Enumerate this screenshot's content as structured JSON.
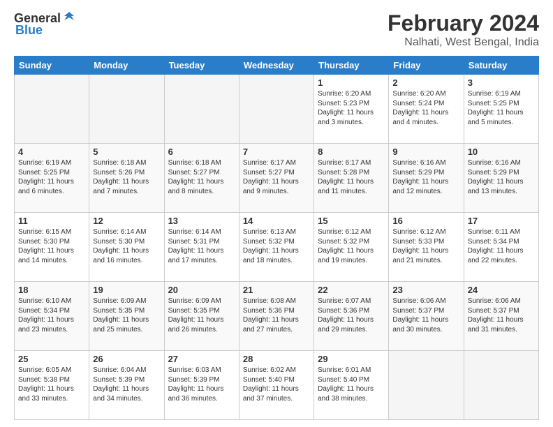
{
  "header": {
    "logo_general": "General",
    "logo_blue": "Blue",
    "title": "February 2024",
    "subtitle": "Nalhati, West Bengal, India"
  },
  "days_of_week": [
    "Sunday",
    "Monday",
    "Tuesday",
    "Wednesday",
    "Thursday",
    "Friday",
    "Saturday"
  ],
  "weeks": [
    [
      {
        "day": "",
        "empty": true
      },
      {
        "day": "",
        "empty": true
      },
      {
        "day": "",
        "empty": true
      },
      {
        "day": "",
        "empty": true
      },
      {
        "day": "1",
        "sunrise": "6:20 AM",
        "sunset": "5:23 PM",
        "daylight": "11 hours and 3 minutes."
      },
      {
        "day": "2",
        "sunrise": "6:20 AM",
        "sunset": "5:24 PM",
        "daylight": "11 hours and 4 minutes."
      },
      {
        "day": "3",
        "sunrise": "6:19 AM",
        "sunset": "5:25 PM",
        "daylight": "11 hours and 5 minutes."
      }
    ],
    [
      {
        "day": "4",
        "sunrise": "6:19 AM",
        "sunset": "5:25 PM",
        "daylight": "11 hours and 6 minutes."
      },
      {
        "day": "5",
        "sunrise": "6:18 AM",
        "sunset": "5:26 PM",
        "daylight": "11 hours and 7 minutes."
      },
      {
        "day": "6",
        "sunrise": "6:18 AM",
        "sunset": "5:27 PM",
        "daylight": "11 hours and 8 minutes."
      },
      {
        "day": "7",
        "sunrise": "6:17 AM",
        "sunset": "5:27 PM",
        "daylight": "11 hours and 9 minutes."
      },
      {
        "day": "8",
        "sunrise": "6:17 AM",
        "sunset": "5:28 PM",
        "daylight": "11 hours and 11 minutes."
      },
      {
        "day": "9",
        "sunrise": "6:16 AM",
        "sunset": "5:29 PM",
        "daylight": "11 hours and 12 minutes."
      },
      {
        "day": "10",
        "sunrise": "6:16 AM",
        "sunset": "5:29 PM",
        "daylight": "11 hours and 13 minutes."
      }
    ],
    [
      {
        "day": "11",
        "sunrise": "6:15 AM",
        "sunset": "5:30 PM",
        "daylight": "11 hours and 14 minutes."
      },
      {
        "day": "12",
        "sunrise": "6:14 AM",
        "sunset": "5:30 PM",
        "daylight": "11 hours and 16 minutes."
      },
      {
        "day": "13",
        "sunrise": "6:14 AM",
        "sunset": "5:31 PM",
        "daylight": "11 hours and 17 minutes."
      },
      {
        "day": "14",
        "sunrise": "6:13 AM",
        "sunset": "5:32 PM",
        "daylight": "11 hours and 18 minutes."
      },
      {
        "day": "15",
        "sunrise": "6:12 AM",
        "sunset": "5:32 PM",
        "daylight": "11 hours and 19 minutes."
      },
      {
        "day": "16",
        "sunrise": "6:12 AM",
        "sunset": "5:33 PM",
        "daylight": "11 hours and 21 minutes."
      },
      {
        "day": "17",
        "sunrise": "6:11 AM",
        "sunset": "5:34 PM",
        "daylight": "11 hours and 22 minutes."
      }
    ],
    [
      {
        "day": "18",
        "sunrise": "6:10 AM",
        "sunset": "5:34 PM",
        "daylight": "11 hours and 23 minutes."
      },
      {
        "day": "19",
        "sunrise": "6:09 AM",
        "sunset": "5:35 PM",
        "daylight": "11 hours and 25 minutes."
      },
      {
        "day": "20",
        "sunrise": "6:09 AM",
        "sunset": "5:35 PM",
        "daylight": "11 hours and 26 minutes."
      },
      {
        "day": "21",
        "sunrise": "6:08 AM",
        "sunset": "5:36 PM",
        "daylight": "11 hours and 27 minutes."
      },
      {
        "day": "22",
        "sunrise": "6:07 AM",
        "sunset": "5:36 PM",
        "daylight": "11 hours and 29 minutes."
      },
      {
        "day": "23",
        "sunrise": "6:06 AM",
        "sunset": "5:37 PM",
        "daylight": "11 hours and 30 minutes."
      },
      {
        "day": "24",
        "sunrise": "6:06 AM",
        "sunset": "5:37 PM",
        "daylight": "11 hours and 31 minutes."
      }
    ],
    [
      {
        "day": "25",
        "sunrise": "6:05 AM",
        "sunset": "5:38 PM",
        "daylight": "11 hours and 33 minutes."
      },
      {
        "day": "26",
        "sunrise": "6:04 AM",
        "sunset": "5:39 PM",
        "daylight": "11 hours and 34 minutes."
      },
      {
        "day": "27",
        "sunrise": "6:03 AM",
        "sunset": "5:39 PM",
        "daylight": "11 hours and 36 minutes."
      },
      {
        "day": "28",
        "sunrise": "6:02 AM",
        "sunset": "5:40 PM",
        "daylight": "11 hours and 37 minutes."
      },
      {
        "day": "29",
        "sunrise": "6:01 AM",
        "sunset": "5:40 PM",
        "daylight": "11 hours and 38 minutes."
      },
      {
        "day": "",
        "empty": true
      },
      {
        "day": "",
        "empty": true
      }
    ]
  ]
}
